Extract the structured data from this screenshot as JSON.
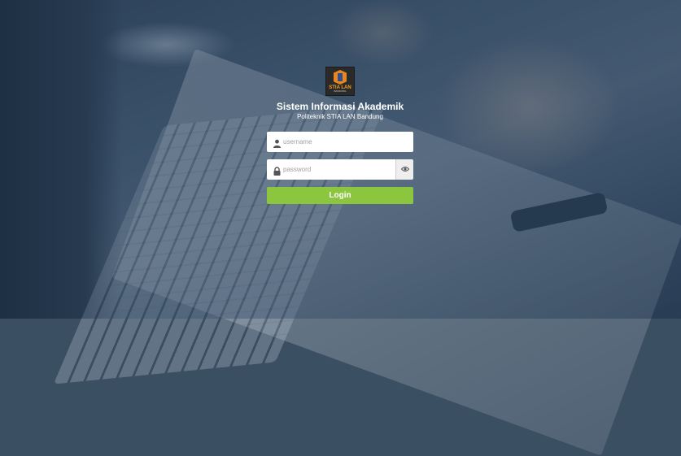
{
  "logo": {
    "text": "STIA LAN",
    "subtext": "BANDUNG"
  },
  "app": {
    "title": "Sistem Informasi Akademik",
    "subtitle": "Politeknik STIA LAN Bandung"
  },
  "form": {
    "username_placeholder": "username",
    "password_placeholder": "password",
    "login_label": "Login"
  },
  "colors": {
    "login_button": "#8cc63f",
    "logo_accent": "#e8871e",
    "overlay": "#1e3755"
  },
  "icons": {
    "username": "user-icon",
    "password": "lock-icon",
    "toggle": "eye-icon"
  }
}
